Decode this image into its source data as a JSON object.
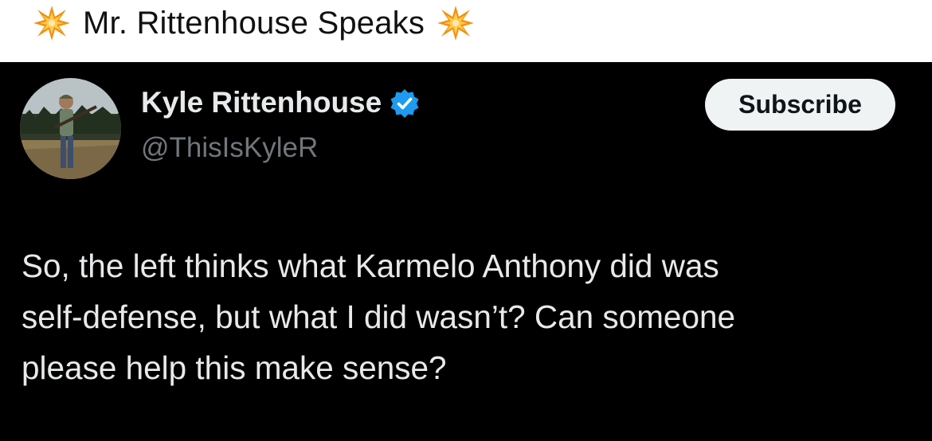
{
  "caption": {
    "text": "Mr. Rittenhouse Speaks",
    "left_icon": "collision-emoji-icon",
    "right_icon": "collision-emoji-icon"
  },
  "tweet": {
    "display_name": "Kyle Rittenhouse",
    "verified_icon": "verified-badge-icon",
    "handle": "@ThisIsKyleR",
    "subscribe_label": "Subscribe",
    "body": "So, the left thinks what Karmelo Anthony  did was\nself-defense, but what I did wasn’t? Can someone\nplease help this make sense?"
  },
  "colors": {
    "tweet_background": "#000000",
    "text_primary": "#e7e9ea",
    "text_secondary": "#71767b",
    "verified_blue": "#1d9bf0",
    "button_background": "#eff3f4"
  }
}
